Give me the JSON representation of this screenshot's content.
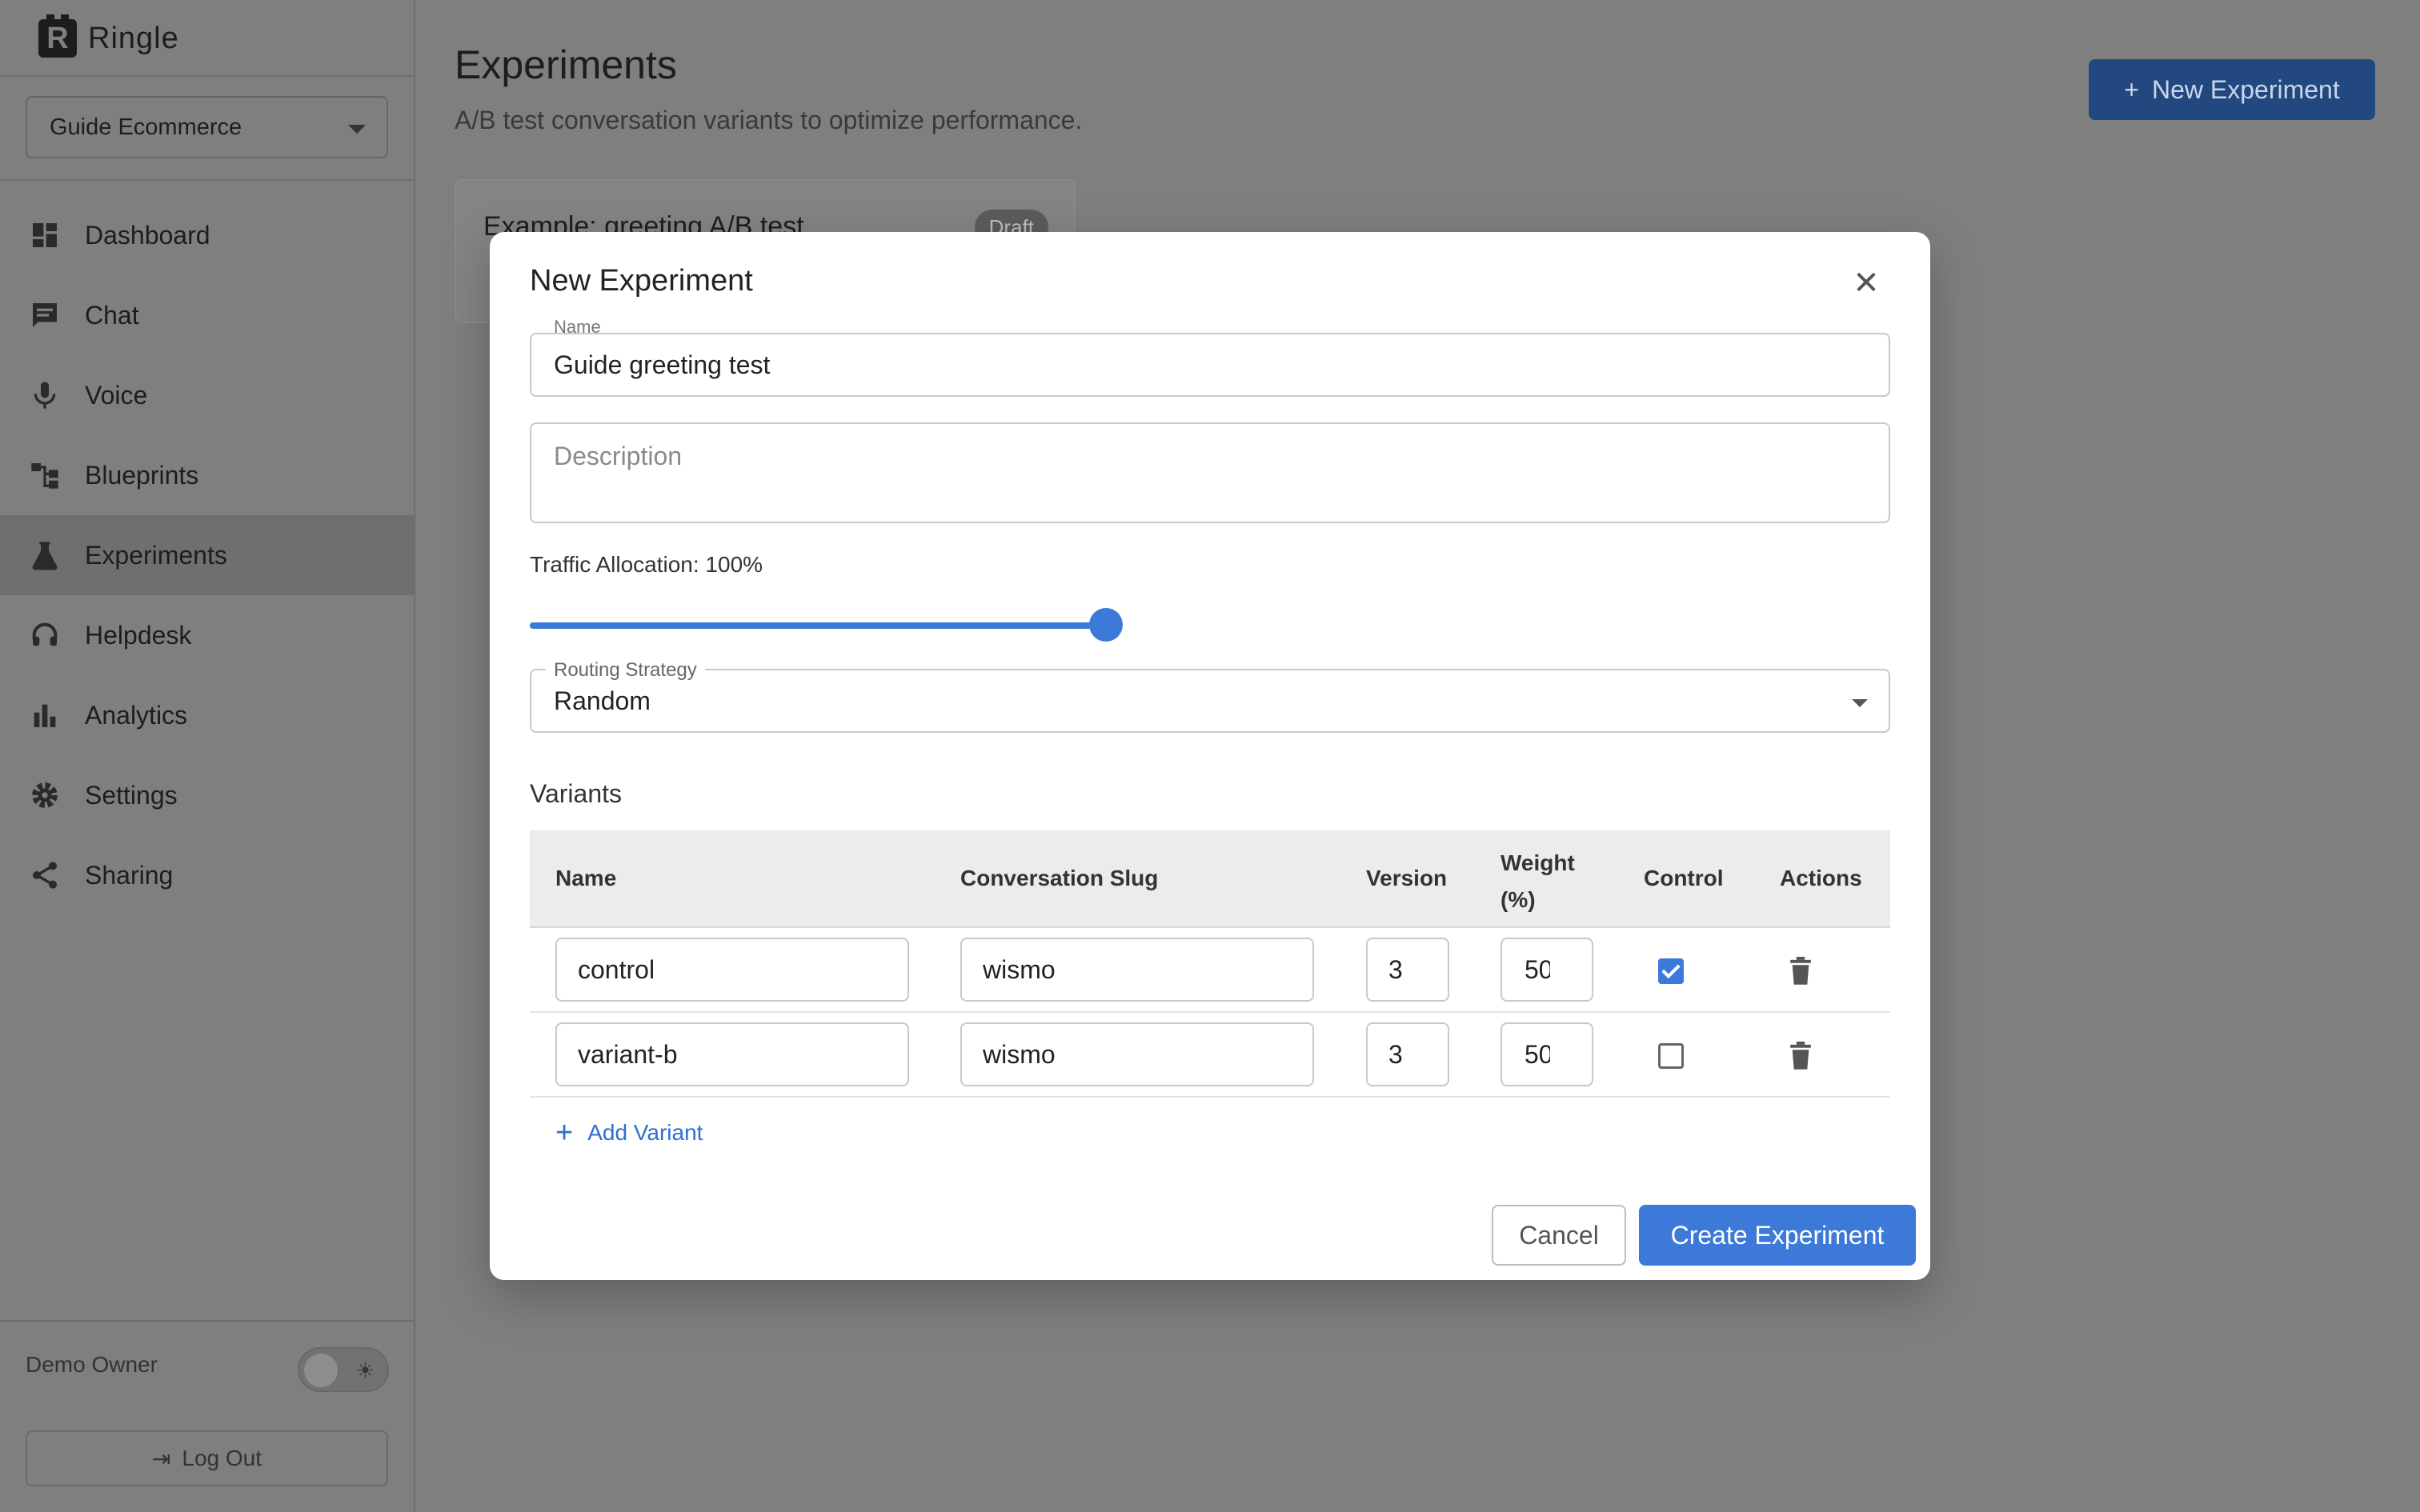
{
  "app": {
    "name": "Ringle"
  },
  "workspace": {
    "selected": "Guide Ecommerce"
  },
  "nav": {
    "items": [
      {
        "label": "Dashboard",
        "icon": "dashboard-icon"
      },
      {
        "label": "Chat",
        "icon": "chat-icon"
      },
      {
        "label": "Voice",
        "icon": "microphone-icon"
      },
      {
        "label": "Blueprints",
        "icon": "blueprint-icon"
      },
      {
        "label": "Experiments",
        "icon": "flask-icon",
        "active": true
      },
      {
        "label": "Helpdesk",
        "icon": "headset-icon"
      },
      {
        "label": "Analytics",
        "icon": "bar-chart-icon"
      },
      {
        "label": "Settings",
        "icon": "gear-icon"
      },
      {
        "label": "Sharing",
        "icon": "share-icon"
      }
    ]
  },
  "footer": {
    "user": "Demo Owner",
    "logout": "Log Out"
  },
  "page": {
    "title": "Experiments",
    "subtitle": "A/B test conversation variants to optimize performance.",
    "new_button": "New Experiment",
    "card": {
      "title": "Example: greeting A/B test",
      "badge": "Draft"
    }
  },
  "modal": {
    "title": "New Experiment",
    "name": {
      "label": "Name",
      "value": "Guide greeting test"
    },
    "description": {
      "placeholder": "Description"
    },
    "traffic": {
      "label": "Traffic Allocation: 100%",
      "value": 100
    },
    "routing": {
      "label": "Routing Strategy",
      "value": "Random"
    },
    "variants_title": "Variants",
    "columns": {
      "name": "Name",
      "slug": "Conversation Slug",
      "version": "Version",
      "weight": "Weight (%)",
      "control": "Control",
      "actions": "Actions"
    },
    "variants": [
      {
        "name": "control",
        "slug": "wismo",
        "version": "3",
        "weight": "50",
        "control": true
      },
      {
        "name": "variant-b",
        "slug": "wismo",
        "version": "3",
        "weight": "50",
        "control": false
      }
    ],
    "add_variant": "Add Variant",
    "cancel": "Cancel",
    "create": "Create Experiment"
  },
  "colors": {
    "accent": "#3c79d8",
    "overlay": "#7f7f7f"
  }
}
